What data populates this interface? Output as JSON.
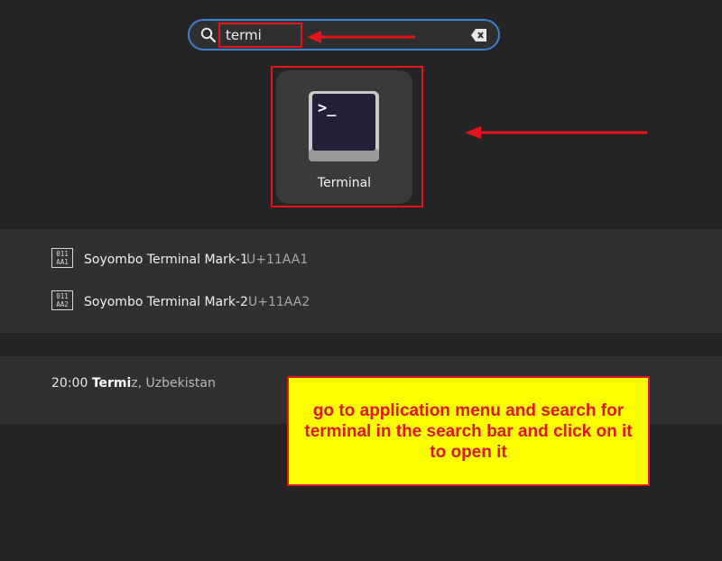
{
  "search": {
    "value": "termi"
  },
  "app_results": [
    {
      "name": "Terminal",
      "icon": "terminal-icon"
    }
  ],
  "characters": [
    {
      "glyph": [
        "011",
        "AA1"
      ],
      "name": "Soyombo Terminal Mark-1",
      "code": "U+11AA1"
    },
    {
      "glyph": [
        "011",
        "AA2"
      ],
      "name": "Soyombo Terminal Mark-2",
      "code": "U+11AA2"
    }
  ],
  "clock": {
    "time": "20:00",
    "city_match": "Termi",
    "city_rest": "z, Uzbekistan"
  },
  "annotation": {
    "text": "go to application menu and search for terminal in the search bar and click on it to open it",
    "highlight_color": "#e4141c",
    "box_color": "#ffff00"
  },
  "colors": {
    "background": "#242424",
    "section": "#303030",
    "accent": "#3f7fd0"
  }
}
